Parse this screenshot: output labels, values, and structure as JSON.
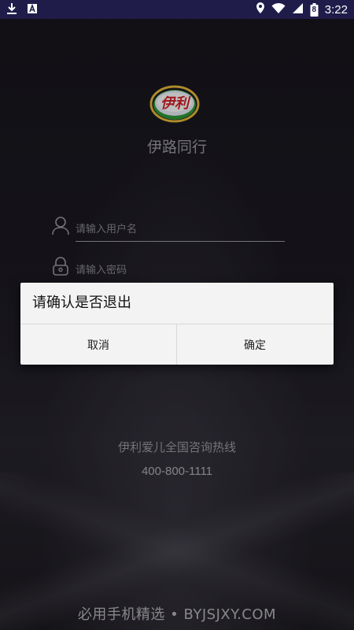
{
  "status_bar": {
    "time": "3:22",
    "battery_level": "8",
    "left_icons": [
      "download-icon",
      "a-box-icon"
    ],
    "right_icons": [
      "location-icon",
      "wifi-icon",
      "signal-icon",
      "battery-icon"
    ],
    "background": "#1f1c4a"
  },
  "app": {
    "logo_text": "伊利",
    "title": "伊路同行"
  },
  "login": {
    "username_placeholder": "请输入用户名",
    "password_placeholder": "请输入密码"
  },
  "hotline": {
    "label": "伊利爱儿全国咨询热线",
    "number": "400-800-1111"
  },
  "watermark": "必用手机精选 • BYJSJXY.COM",
  "dialog": {
    "title": "请确认是否退出",
    "cancel_label": "取消",
    "confirm_label": "确定"
  }
}
